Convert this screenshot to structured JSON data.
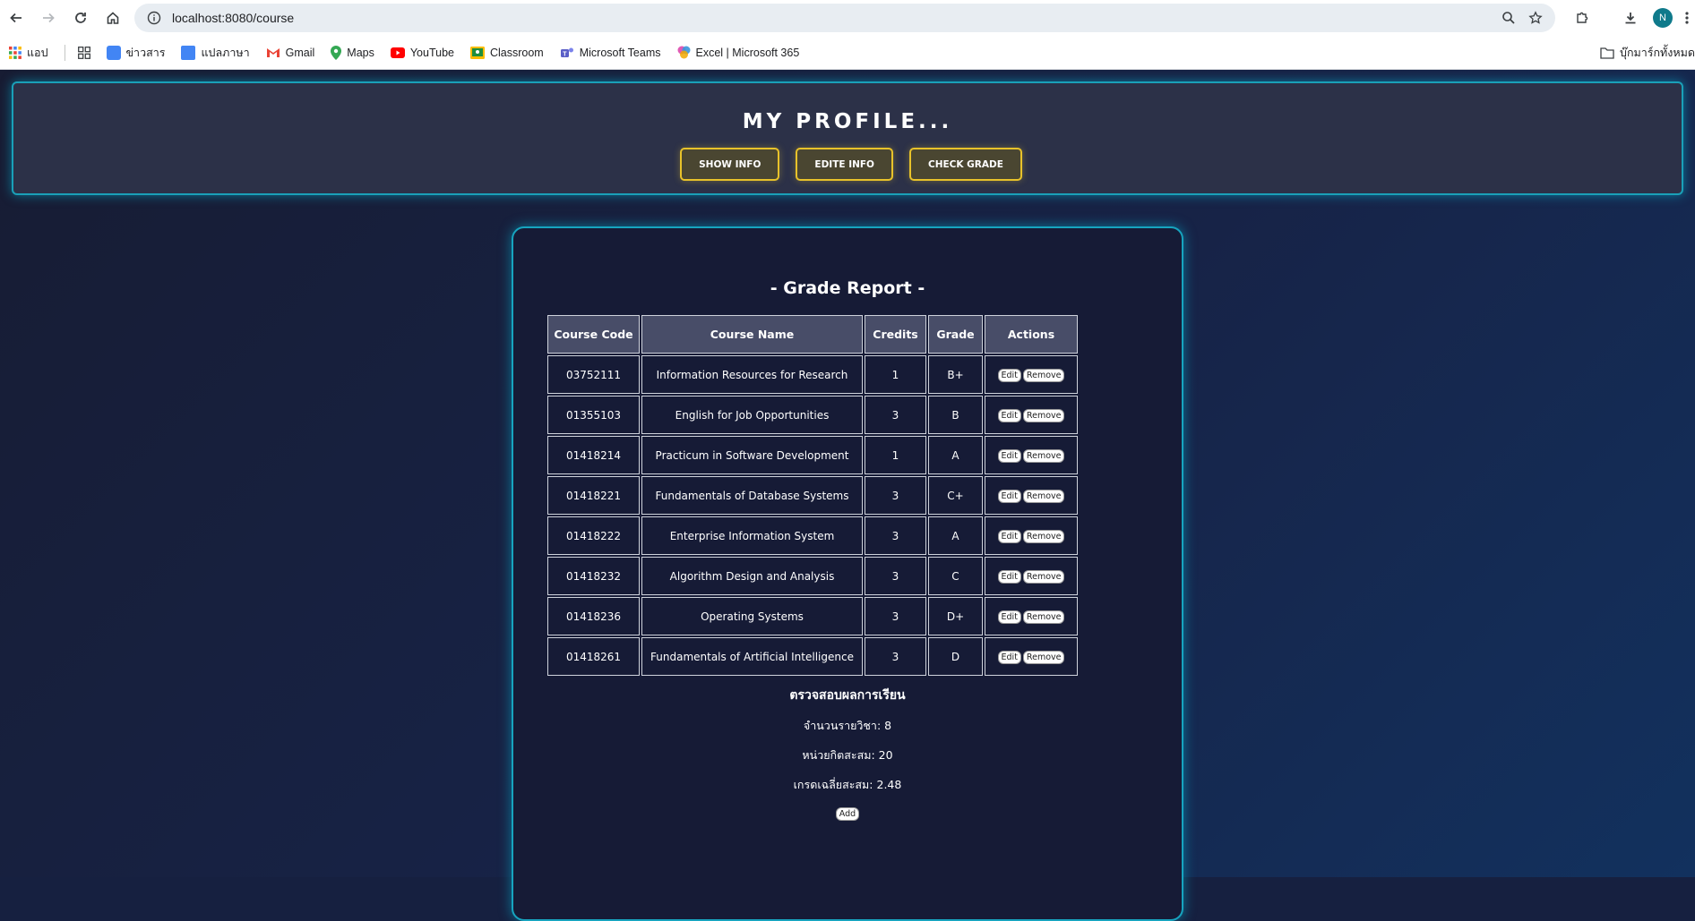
{
  "browser": {
    "url": "localhost:8080/course",
    "profile_initial": "N",
    "bookmarks": [
      {
        "label": "แอป",
        "icon": "apps-icon",
        "color": "#e94235"
      },
      {
        "label": "",
        "icon": "grid-icon",
        "color": "#3c4043"
      },
      {
        "label": "ข่าวสาร",
        "icon": "news-icon",
        "color": "#4285f4"
      },
      {
        "label": "แปลภาษา",
        "icon": "translate-icon",
        "color": "#4285f4"
      },
      {
        "label": "Gmail",
        "icon": "gmail-icon",
        "color": "#ea4335"
      },
      {
        "label": "Maps",
        "icon": "maps-icon",
        "color": "#34a853"
      },
      {
        "label": "YouTube",
        "icon": "youtube-icon",
        "color": "#ff0000"
      },
      {
        "label": "Classroom",
        "icon": "classroom-icon",
        "color": "#fbbc04"
      },
      {
        "label": "Microsoft Teams",
        "icon": "teams-icon",
        "color": "#5b5fc7"
      },
      {
        "label": "Excel | Microsoft 365",
        "icon": "microsoft365-icon",
        "color": "#e05ab5"
      }
    ],
    "all_bookmarks_label": "บุ๊กมาร์กทั้งหมด"
  },
  "header": {
    "title": "MY PROFILE...",
    "buttons": [
      {
        "label": "SHOW INFO",
        "name": "show-info-button"
      },
      {
        "label": "EDITE INFO",
        "name": "edite-info-button"
      },
      {
        "label": "CHECK GRADE",
        "name": "check-grade-button"
      }
    ]
  },
  "report": {
    "title": "- Grade Report -",
    "columns": [
      "Course Code",
      "Course Name",
      "Credits",
      "Grade",
      "Actions"
    ],
    "edit_label": "Edit",
    "remove_label": "Remove",
    "rows": [
      {
        "code": "03752111",
        "name": "Information Resources for Research",
        "credits": "1",
        "grade": "B+"
      },
      {
        "code": "01355103",
        "name": "English for Job Opportunities",
        "credits": "3",
        "grade": "B"
      },
      {
        "code": "01418214",
        "name": "Practicum in Software Development",
        "credits": "1",
        "grade": "A"
      },
      {
        "code": "01418221",
        "name": "Fundamentals of Database Systems",
        "credits": "3",
        "grade": "C+"
      },
      {
        "code": "01418222",
        "name": "Enterprise Information System",
        "credits": "3",
        "grade": "A"
      },
      {
        "code": "01418232",
        "name": "Algorithm Design and Analysis",
        "credits": "3",
        "grade": "C"
      },
      {
        "code": "01418236",
        "name": "Operating Systems",
        "credits": "3",
        "grade": "D+"
      },
      {
        "code": "01418261",
        "name": "Fundamentals of Artificial Intelligence",
        "credits": "3",
        "grade": "D"
      }
    ]
  },
  "summary": {
    "title": "ตรวจสอบผลการเรียน",
    "course_count_label": "จำนวนรายวิชา:",
    "course_count": "8",
    "total_credits_label": "หน่วยกิตสะสม:",
    "total_credits": "20",
    "gpa_label": "เกรดเฉลี่ยสะสม:",
    "gpa": "2.48",
    "add_label": "Add"
  }
}
